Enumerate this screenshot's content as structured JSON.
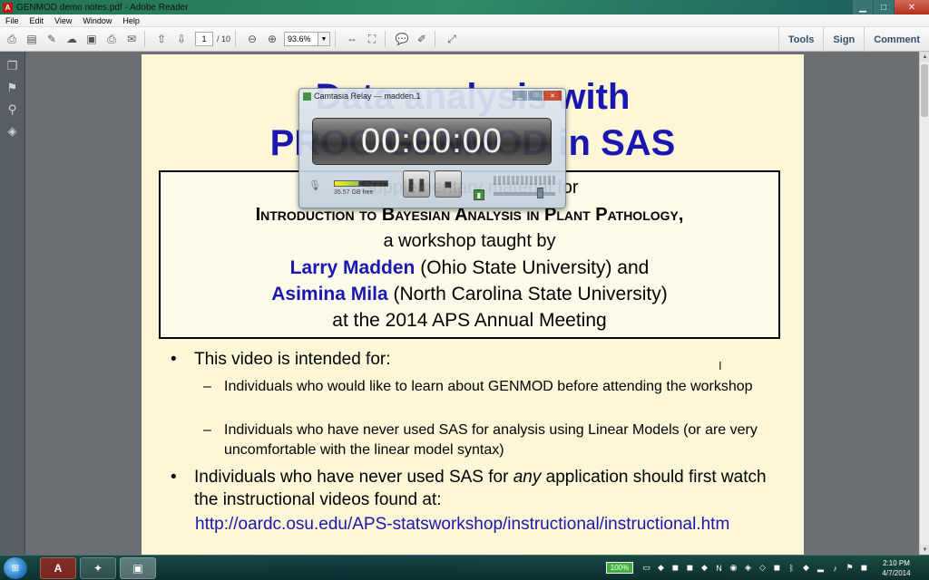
{
  "window": {
    "title": "GENMOD demo notes.pdf - Adobe Reader",
    "minimize": "▁",
    "maximize": "□",
    "close": "✕"
  },
  "menu": [
    "File",
    "Edit",
    "View",
    "Window",
    "Help"
  ],
  "toolbar": {
    "page_current": "1",
    "page_total": "/ 10",
    "zoom": "93.6%",
    "right_tabs": [
      "Tools",
      "Sign",
      "Comment"
    ]
  },
  "slide": {
    "title_line1": "Data analysis with",
    "title_line2": "PROC GENMOD in SAS",
    "box": {
      "line1": "Supplementary material for",
      "line2": "Introduction to Bayesian Analysis in Plant Pathology,",
      "line3": "a workshop taught by",
      "name1": "Larry Madden",
      "affil1": " (Ohio State University) and",
      "name2": "Asimina Mila",
      "affil2": " (North Carolina State University)",
      "line6": "at the 2014 APS Annual Meeting"
    },
    "bullet1": "This video is intended for:",
    "sub1": "Individuals who would like to learn about GENMOD before attending the workshop",
    "sub2": "Individuals who have never used SAS for analysis using Linear Models (or are very uncomfortable with the linear model syntax)",
    "bullet2_pre": "Individuals who have never used SAS for ",
    "bullet2_em": "any",
    "bullet2_post": " application should first watch the instructional videos found at:",
    "link": "http://oardc.osu.edu/APS-statsworkshop/instructional/instructional.htm"
  },
  "camtasia": {
    "title": "Camtasia Relay — madden.1",
    "timer": "00:00:00",
    "free_space": "35.57 GB free"
  },
  "taskbar": {
    "battery": "100%",
    "time": "2:10 PM",
    "date": "4/7/2014"
  },
  "colors": {
    "title_blue": "#1a17b0",
    "slide_bg": "#fdf7d8",
    "doc_bg": "#6a6f74"
  }
}
